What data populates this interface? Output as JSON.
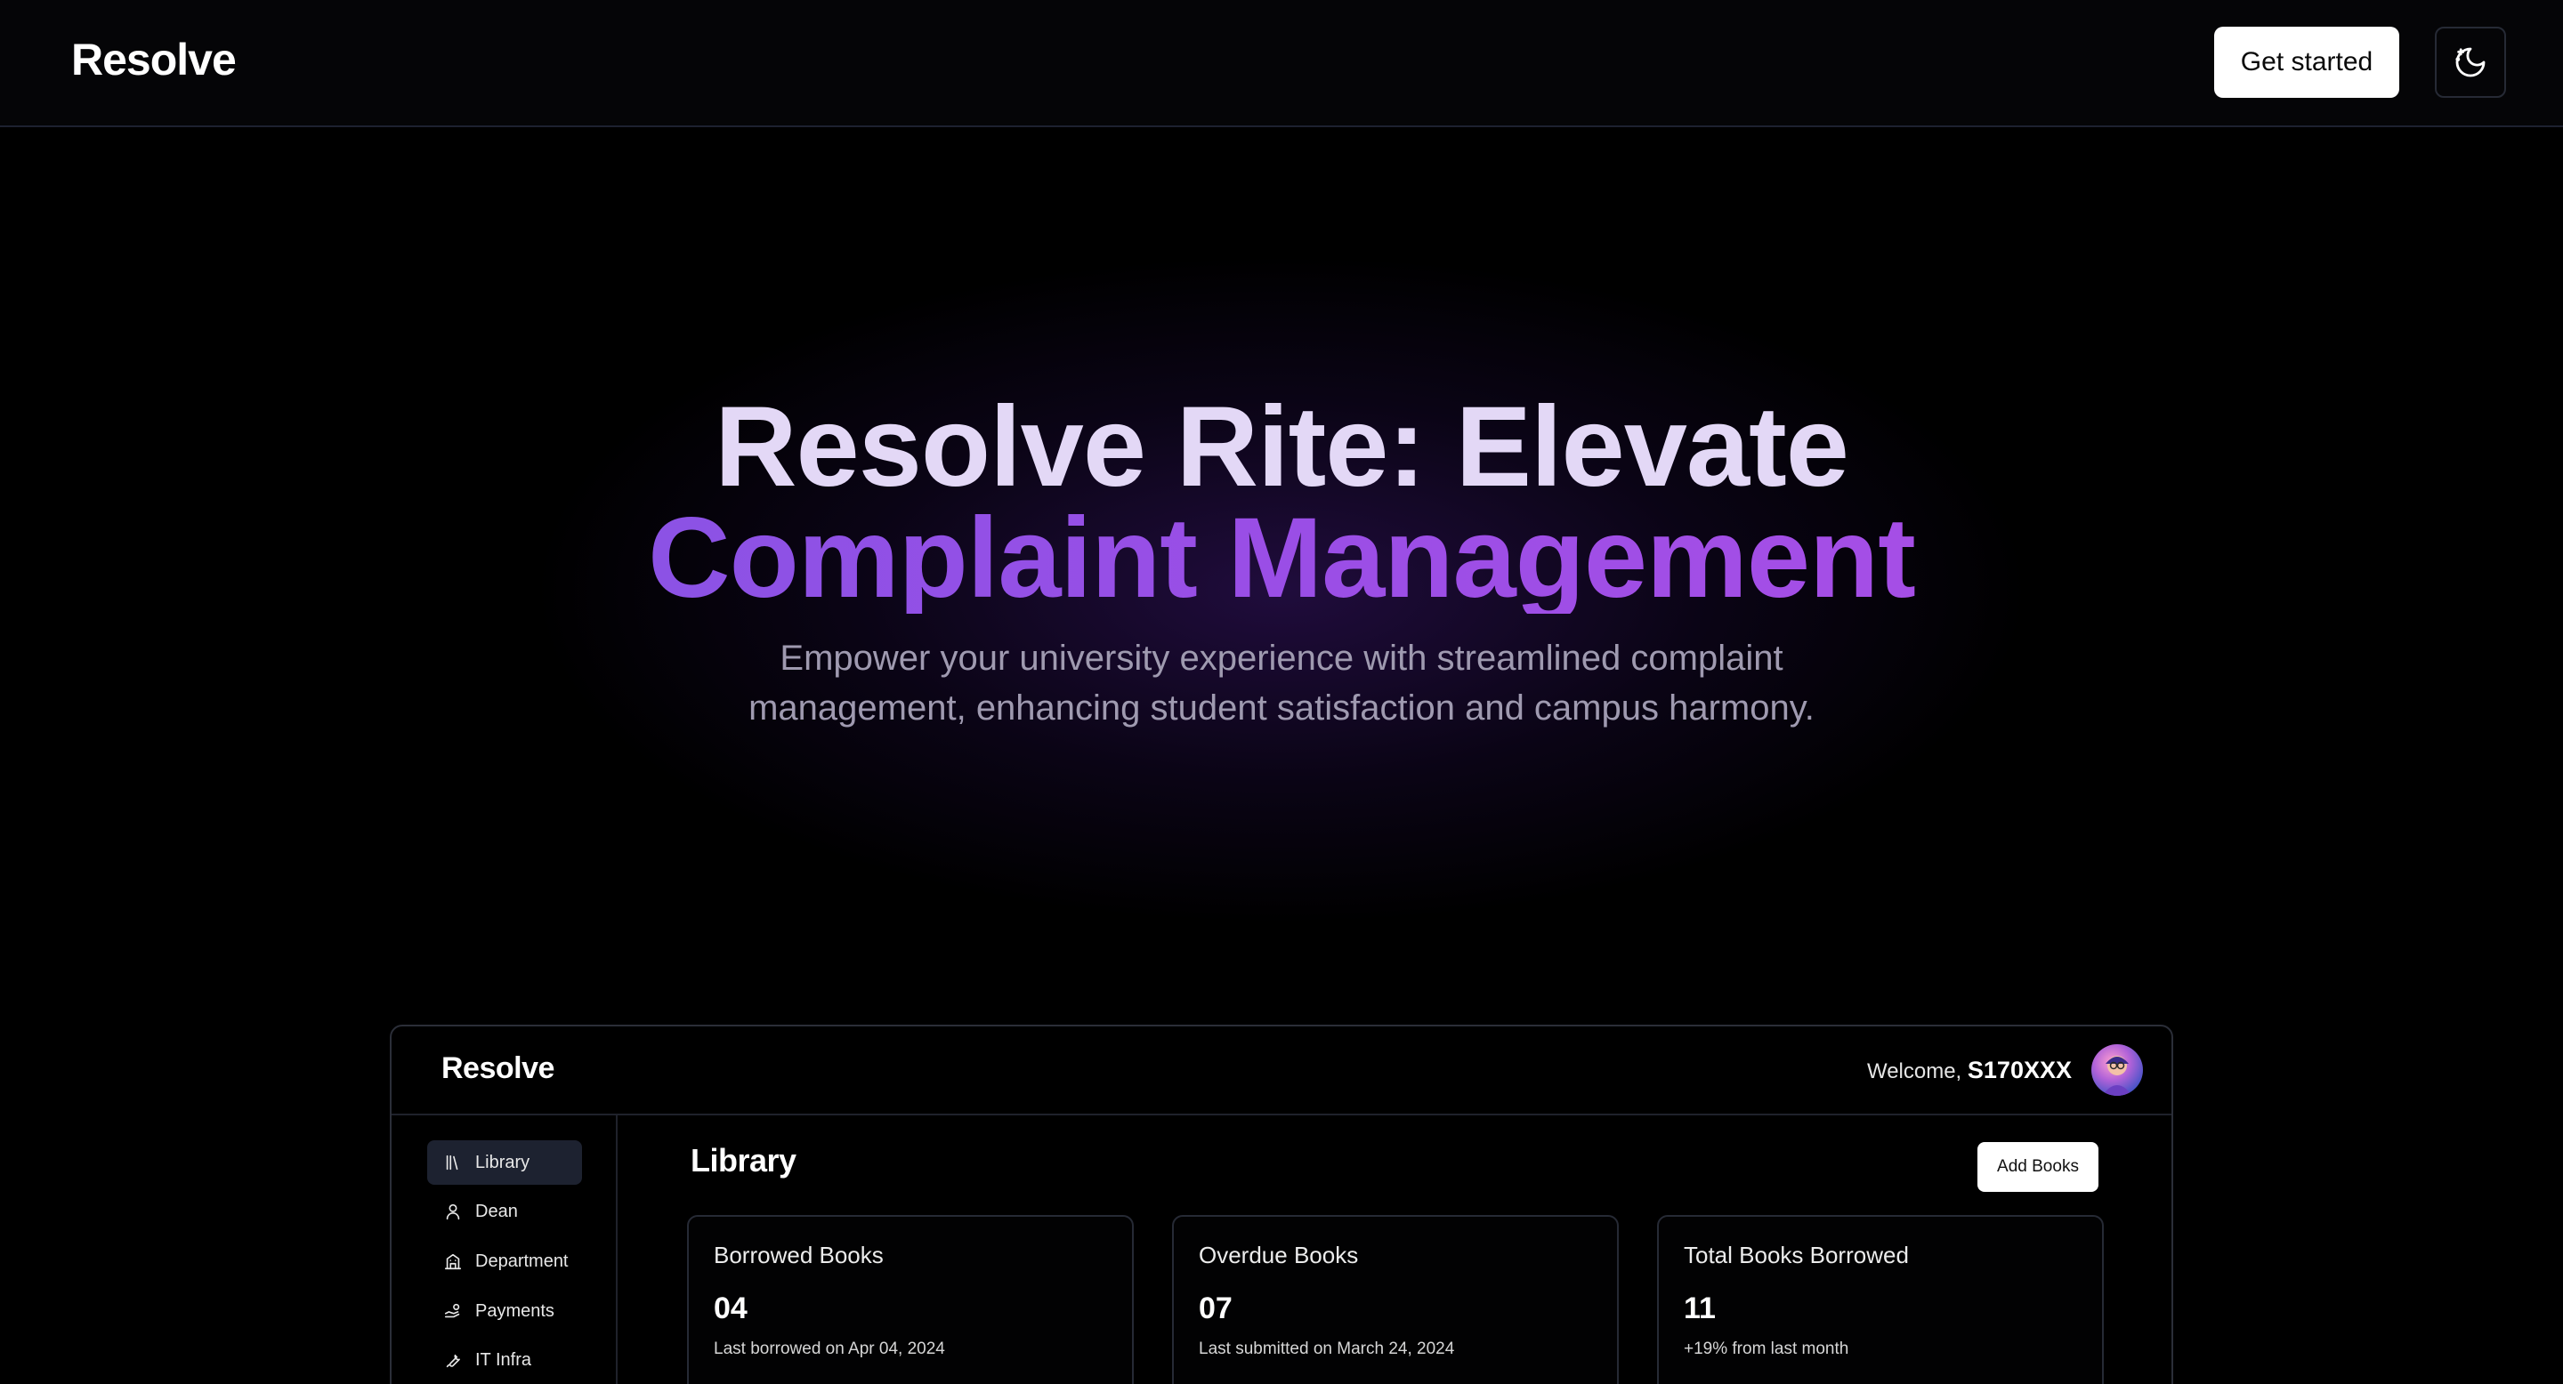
{
  "header": {
    "logo": "Resolve",
    "cta_label": "Get started",
    "theme_toggle_icon": "moon-stars-icon"
  },
  "hero": {
    "title_line1": "Resolve Rite: Elevate",
    "title_line2": "Complaint Management",
    "subtitle": "Empower your university experience with streamlined complaint management, enhancing student satisfaction and campus harmony."
  },
  "dashboard": {
    "logo": "Resolve",
    "welcome_prefix": "Welcome,",
    "user_id": "S170XXX",
    "sidebar": {
      "items": [
        {
          "label": "Library",
          "icon": "library-icon",
          "active": true
        },
        {
          "label": "Dean",
          "icon": "user-icon",
          "active": false
        },
        {
          "label": "Department",
          "icon": "building-icon",
          "active": false
        },
        {
          "label": "Payments",
          "icon": "hand-coins-icon",
          "active": false
        },
        {
          "label": "IT Infra",
          "icon": "wrench-icon",
          "active": false
        }
      ]
    },
    "main": {
      "title": "Library",
      "add_button": "Add Books",
      "cards": [
        {
          "title": "Borrowed Books",
          "value": "04",
          "note": "Last borrowed on Apr 04, 2024"
        },
        {
          "title": "Overdue Books",
          "value": "07",
          "note": "Last submitted on March 24, 2024"
        },
        {
          "title": "Total Books Borrowed",
          "value": "11",
          "note": "+19% from last month"
        }
      ]
    }
  },
  "colors": {
    "background": "#000000",
    "hero_line1": "#e3d8f6",
    "accent_gradient_start": "#7c56e4",
    "accent_gradient_end": "#b14ee6",
    "subtitle": "#9f9ab0"
  }
}
